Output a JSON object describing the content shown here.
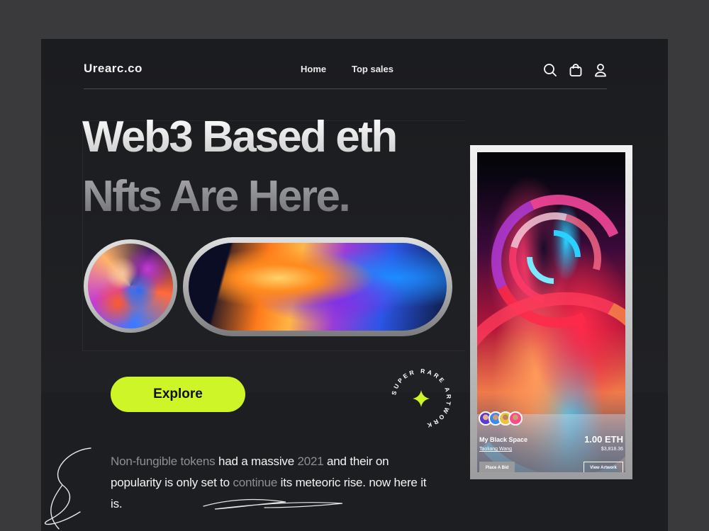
{
  "nav": {
    "logo": "Urearc.co",
    "links": [
      {
        "label": "Home"
      },
      {
        "label": "Top sales"
      }
    ],
    "icons": [
      "search-icon",
      "bag-icon",
      "user-icon"
    ]
  },
  "hero": {
    "line1": "Web3 Based eth",
    "line2": "Nfts Are Here."
  },
  "explore_label": "Explore",
  "badge": {
    "text": "SUPER RARE ARTWORK"
  },
  "description": {
    "p1": "Non-fungible tokens",
    "p2": " had a massive ",
    "p3": "2021",
    "p4": " and their on popularity is only set to ",
    "p5": "continue",
    "p6": " its meteoric rise. now here it is."
  },
  "card": {
    "title": "My Black Space",
    "author": "Taoliang Wang",
    "price": "1.00 ETH",
    "usd": "$3,818.36",
    "bid_label": "Place A Bid",
    "view_label": "View Artwork"
  },
  "colors": {
    "accent": "#cdf527",
    "background": "#1b1c1f",
    "outer": "#3a3a3c"
  }
}
